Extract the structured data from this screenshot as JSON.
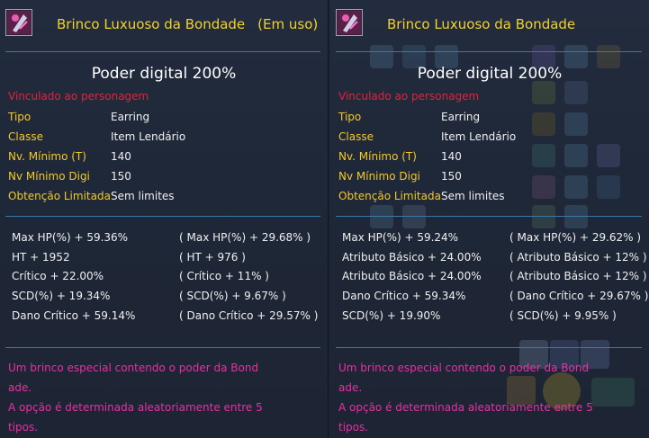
{
  "left_panel": {
    "item_name": "Brinco Luxuoso da Bondade",
    "status": "(Em uso)",
    "power": "Poder digital 200%",
    "bound": "Vinculado ao personagem",
    "info": [
      {
        "label": "Tipo",
        "value": "Earring"
      },
      {
        "label": "Classe",
        "value": "Item Lendário"
      },
      {
        "label": "Nv. Mínimo (T)",
        "value": "140"
      },
      {
        "label": "Nv Mínimo Digi",
        "value": "150"
      },
      {
        "label": "Obtenção Limitada",
        "value": "Sem limites"
      }
    ],
    "stats": [
      {
        "main": "Max HP(%) + 59.36%",
        "sub": "( Max HP(%) + 29.68% )"
      },
      {
        "main": "HT + 1952",
        "sub": "( HT + 976 )"
      },
      {
        "main": "Crítico + 22.00%",
        "sub": "( Crítico + 11% )"
      },
      {
        "main": "SCD(%) + 19.34%",
        "sub": "( SCD(%) + 9.67% )"
      },
      {
        "main": "Dano Crítico + 59.14%",
        "sub": "( Dano Crítico + 29.57% )"
      }
    ],
    "description": [
      "Um brinco especial contendo o poder da Bond",
      "ade.",
      "A opção é determinada aleatoriamente entre 5",
      "tipos."
    ]
  },
  "right_panel": {
    "item_name": "Brinco Luxuoso da Bondade",
    "power": "Poder digital 200%",
    "bound": "Vinculado ao personagem",
    "info": [
      {
        "label": "Tipo",
        "value": "Earring"
      },
      {
        "label": "Classe",
        "value": "Item Lendário"
      },
      {
        "label": "Nv. Mínimo (T)",
        "value": "140"
      },
      {
        "label": "Nv Mínimo Digi",
        "value": "150"
      },
      {
        "label": "Obtenção Limitada",
        "value": "Sem limites"
      }
    ],
    "stats": [
      {
        "main": "Max HP(%) + 59.24%",
        "sub": "( Max HP(%) + 29.62% )"
      },
      {
        "main": "Atributo Básico + 24.00%",
        "sub": "( Atributo Básico + 12% )"
      },
      {
        "main": "Atributo Básico + 24.00%",
        "sub": "( Atributo Básico + 12% )"
      },
      {
        "main": "Dano Crítico + 59.34%",
        "sub": "( Dano Crítico + 29.67% )"
      },
      {
        "main": "SCD(%) + 19.90%",
        "sub": "( SCD(%) + 9.95% )"
      }
    ],
    "description": [
      "Um brinco especial contendo o poder da Bond",
      "ade.",
      "A opção é determinada aleatoriamente entre 5",
      "tipos."
    ]
  },
  "icons": {
    "item": "earring-item-icon"
  },
  "colors": {
    "title": "#f2d22a",
    "label": "#f3c92a",
    "bound": "#e0243c",
    "description": "#ea2fa3",
    "divider": "#3a78a8"
  }
}
